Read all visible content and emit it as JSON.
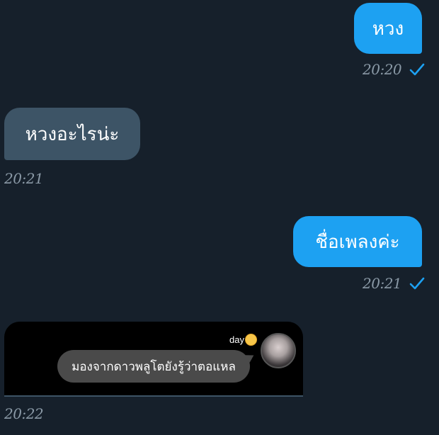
{
  "messages": [
    {
      "direction": "out",
      "text": "หวง",
      "time": "20:20",
      "status_icon": "checkmark-icon"
    },
    {
      "direction": "in",
      "text": "หวงอะไรน่ะ",
      "time": "20:21"
    },
    {
      "direction": "out",
      "text": "ชื่อเพลงค่ะ",
      "time": "20:21",
      "status_icon": "checkmark-icon"
    },
    {
      "direction": "in",
      "type": "image",
      "time": "20:22",
      "image": {
        "name": "day",
        "name_icon": "sun-emoji-icon",
        "caption": "มองจากดาวพลูโตยังรู้ว่าตอแหล"
      }
    }
  ],
  "colors": {
    "background": "#16202b",
    "outgoing_bubble": "#1da1f2",
    "incoming_bubble": "#3d5466",
    "timestamp": "#8a99a6",
    "check": "#1da1f2"
  }
}
